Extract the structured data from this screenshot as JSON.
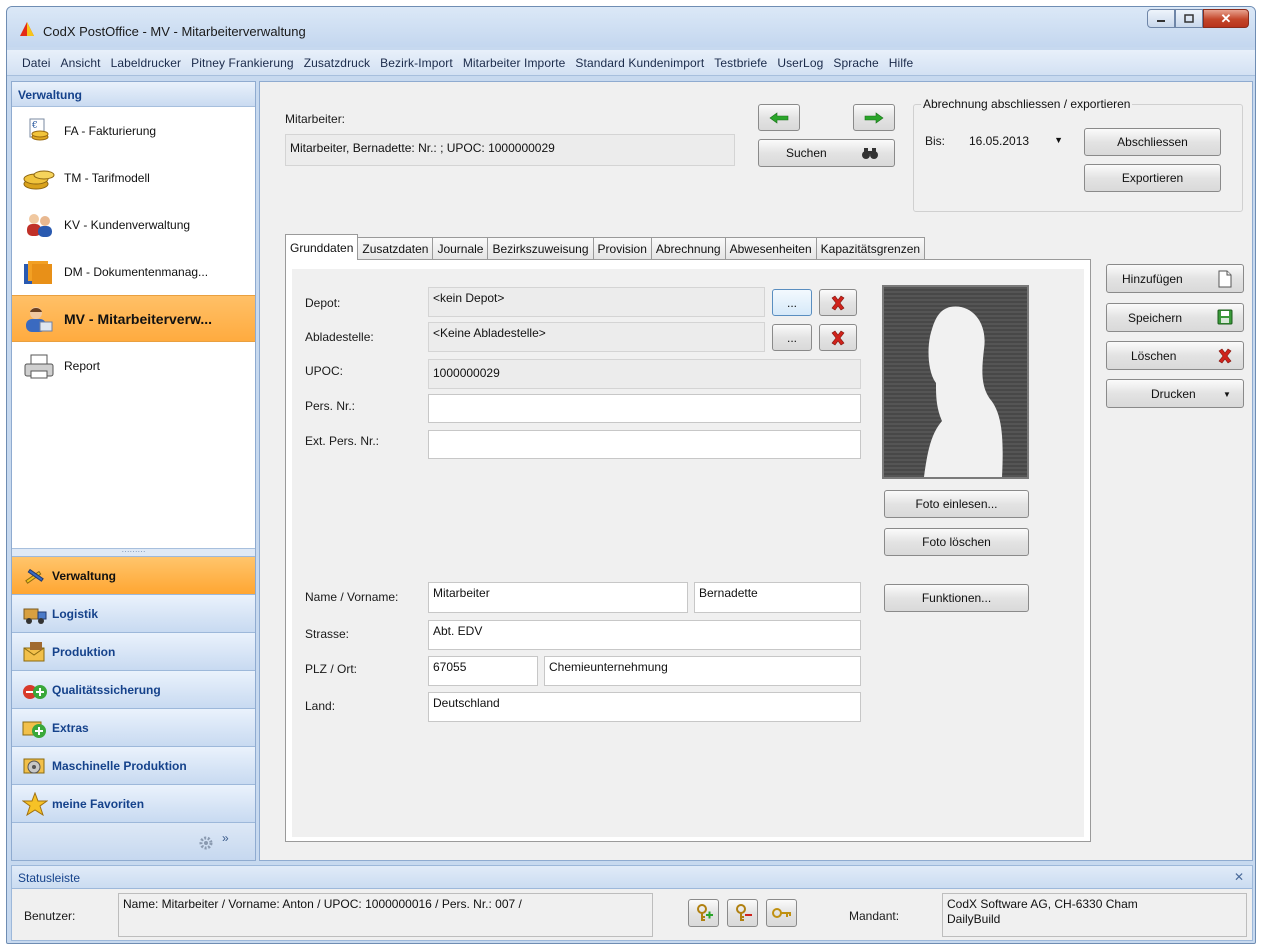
{
  "window": {
    "title": "CodX PostOffice - MV - Mitarbeiterverwaltung"
  },
  "menu": [
    "Datei",
    "Ansicht",
    "Labeldrucker",
    "Pitney Frankierung",
    "Zusatzdruck",
    "Bezirk-Import",
    "Mitarbeiter Importe",
    "Standard Kundenimport",
    "Testbriefe",
    "UserLog",
    "Sprache",
    "Hilfe"
  ],
  "sidebar": {
    "header": "Verwaltung",
    "modules": [
      {
        "label": "FA - Fakturierung",
        "icon": "invoice-coins-icon"
      },
      {
        "label": "TM - Tarifmodell",
        "icon": "coins-stack-icon"
      },
      {
        "label": "KV - Kundenverwaltung",
        "icon": "customers-icon"
      },
      {
        "label": "DM - Dokumentenmanag...",
        "icon": "documents-folder-icon"
      },
      {
        "label": "MV - Mitarbeiterverw...",
        "icon": "employee-icon",
        "active": true
      },
      {
        "label": "Report",
        "icon": "printer-icon"
      }
    ],
    "groups": [
      {
        "label": "Verwaltung",
        "icon": "admin-tools-icon",
        "active": true
      },
      {
        "label": "Logistik",
        "icon": "logistics-truck-icon"
      },
      {
        "label": "Produktion",
        "icon": "production-envelope-icon"
      },
      {
        "label": "Qualitätssicherung",
        "icon": "quality-icon"
      },
      {
        "label": "Extras",
        "icon": "extras-icon"
      },
      {
        "label": "Maschinelle Produktion",
        "icon": "machine-production-icon"
      },
      {
        "label": "meine Favoriten",
        "icon": "favorites-star-icon"
      }
    ],
    "footer_chevron": "»"
  },
  "employee": {
    "label": "Mitarbeiter:",
    "value": "Mitarbeiter, Bernadette: Nr.: ; UPOC: 1000000029",
    "search_label": "Suchen"
  },
  "billing": {
    "title": "Abrechnung abschliessen / exportieren",
    "until_label": "Bis:",
    "until_value": "16.05.2013",
    "close_label": "Abschliessen",
    "export_label": "Exportieren"
  },
  "tabs": [
    "Grunddaten",
    "Zusatzdaten",
    "Journale",
    "Bezirkszuweisung",
    "Provision",
    "Abrechnung",
    "Abwesenheiten",
    "Kapazitätsgrenzen"
  ],
  "form": {
    "depot_label": "Depot:",
    "depot_value": "<kein Depot>",
    "unload_label": "Abladestelle:",
    "unload_value": "<Keine Abladestelle>",
    "browse_label": "...",
    "upoc_label": "UPOC:",
    "upoc_value": "1000000029",
    "persnr_label": "Pers. Nr.:",
    "persnr_value": "",
    "extpersnr_label": "Ext. Pers. Nr.:",
    "extpersnr_value": "",
    "name_label": "Name / Vorname:",
    "name_value": "Mitarbeiter",
    "firstname_value": "Bernadette",
    "street_label": "Strasse:",
    "street_value": "Abt. EDV",
    "zip_label": "PLZ / Ort:",
    "zip_value": "67055",
    "city_value": "Chemieunternehmung",
    "country_label": "Land:",
    "country_value": "Deutschland"
  },
  "photo": {
    "load_label": "Foto einlesen...",
    "delete_label": "Foto löschen",
    "functions_label": "Funktionen..."
  },
  "actions": {
    "add": "Hinzufügen",
    "save": "Speichern",
    "delete": "Löschen",
    "print": "Drucken"
  },
  "status": {
    "header": "Statusleiste",
    "user_label": "Benutzer:",
    "user_value": "Name: Mitarbeiter / Vorname: Anton / UPOC: 1000000016 / Pers. Nr.: 007 /",
    "client_label": "Mandant:",
    "client_line1": "CodX Software AG, CH-6330 Cham",
    "client_line2": "DailyBuild",
    "close_glyph": "✕"
  },
  "colors": {
    "accent_orange": "#ffab3f",
    "nav_text": "#15428b",
    "delete_red": "#d0231c",
    "arrow_green": "#2aa52a"
  }
}
